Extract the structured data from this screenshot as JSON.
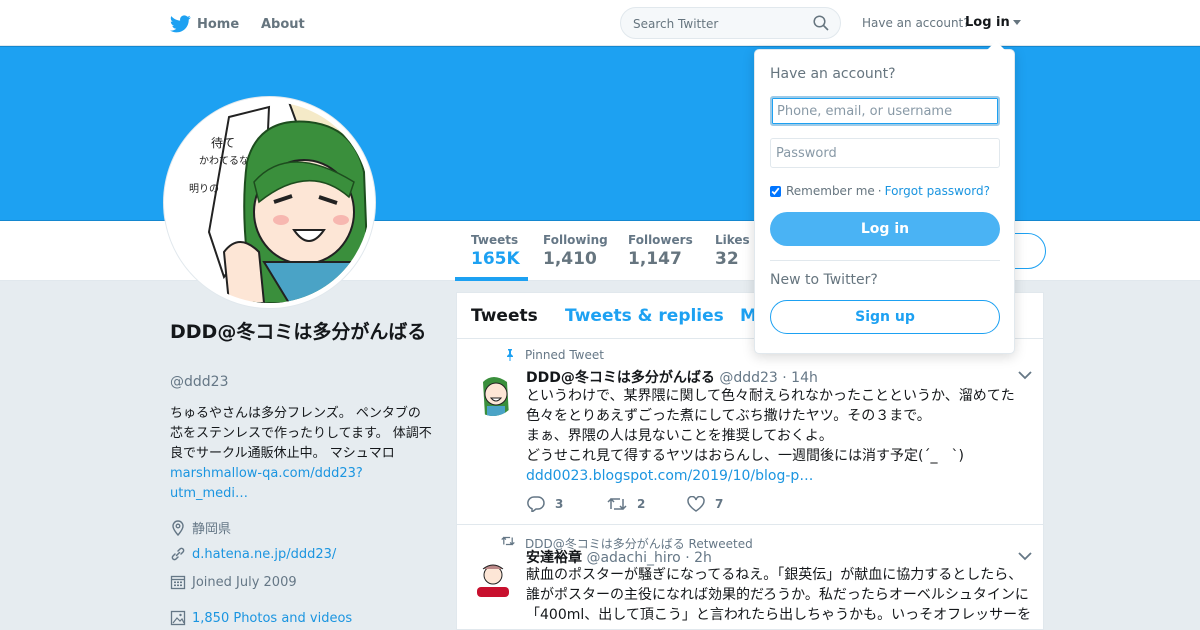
{
  "nav": {
    "home_label": "Home",
    "about_label": "About",
    "search_placeholder": "Search Twitter",
    "have_account": "Have an account?",
    "login_label": "Log in"
  },
  "colors": {
    "brand": "#1da1f2",
    "link": "#1b95e0",
    "muted": "#657786"
  },
  "stats": [
    {
      "label": "Tweets",
      "value": "165K",
      "active": true
    },
    {
      "label": "Following",
      "value": "1,410"
    },
    {
      "label": "Followers",
      "value": "1,147"
    },
    {
      "label": "Likes",
      "value": "32"
    }
  ],
  "profile": {
    "name": "DDD@冬コミは多分がんばる",
    "handle": "@ddd23",
    "bio_text": "ちゅるやさんは多分フレンズ。 ペンタブの芯をステンレスで作ったりしてます。 体調不良でサークル通販休止中。 マシュマロ",
    "bio_link": "marshmallow-qa.com/ddd23?utm_medi…",
    "location": "静岡県",
    "website": "d.hatena.ne.jp/ddd23/",
    "joined": "Joined July 2009",
    "photos": "1,850 Photos and videos"
  },
  "timeline": {
    "tabs": [
      "Tweets",
      "Tweets & replies",
      "M"
    ]
  },
  "tweets": [
    {
      "context": "Pinned Tweet",
      "name": "DDD@冬コミは多分がんばる",
      "handle": "@ddd23",
      "time": "· 14h",
      "lines": [
        "というわけで、某界隈に関して色々耐えられなかったことというか、溜めてた",
        "色々をとりあえずごった煮にしてぶち撒けたヤツ。その３まで。",
        "まぁ、界隈の人は見ないことを推奨しておくよ。",
        "どうせこれ見て得するヤツはおらんし、一週間後には消す予定(´_　`)"
      ],
      "link": "ddd0023.blogspot.com/2019/10/blog-p…",
      "replies": "3",
      "retweets": "2",
      "likes": "7"
    },
    {
      "context": "DDD@冬コミは多分がんばる Retweeted",
      "name": "安達裕章",
      "handle": "@adachi_hiro",
      "time": "· 2h",
      "lines": [
        "献血のポスターが騒ぎになってるねえ。「銀英伝」が献血に協力するとしたら、",
        "誰がポスターの主役になれば効果的だろうか。私だったらオーベルシュタインに",
        "「400ml、出して頂こう」と言われたら出しちゃうかも。いっそオフレッサーを"
      ]
    }
  ],
  "login_dropdown": {
    "title": "Have an account?",
    "username_placeholder": "Phone, email, or username",
    "password_placeholder": "Password",
    "remember": "Remember me",
    "separator": "·",
    "forgot": "Forgot password?",
    "login_button": "Log in",
    "new_to": "New to Twitter?",
    "signup_button": "Sign up"
  }
}
